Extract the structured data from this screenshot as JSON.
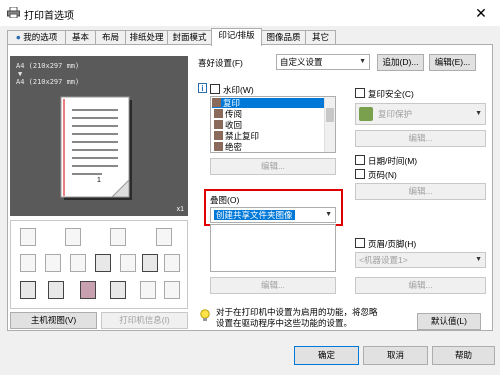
{
  "window": {
    "title": "打印首选项",
    "close_glyph": "✕"
  },
  "tabs": [
    "我的选项",
    "基本",
    "布局",
    "排纸处理",
    "封面模式",
    "印记/排版",
    "图像品质",
    "其它"
  ],
  "preview": {
    "line1": "A4 (210x297 mm)",
    "arrow": "▼",
    "line2": "A4 (210x297 mm)",
    "copies": "x1",
    "page_num": "1"
  },
  "left_buttons": {
    "main_view": "主机视图(V)",
    "printer_info": "打印机信息(I)"
  },
  "favorite": {
    "label": "喜好设置(F)",
    "value": "自定义设置",
    "add": "追加(D)...",
    "edit": "编辑(E)..."
  },
  "watermark": {
    "label": "水印(W)",
    "items": [
      "复印",
      "传阅",
      "收回",
      "禁止复印",
      "绝密"
    ],
    "edit": "编辑..."
  },
  "overlay": {
    "label": "叠图(O)",
    "value": "创建共享文件夹图像",
    "edit": "编辑..."
  },
  "copy_security": {
    "label": "复印安全(C)",
    "value": "复印保护",
    "edit": "编辑..."
  },
  "datetime": {
    "label": "日期/时间(M)"
  },
  "page_number": {
    "label": "页码(N)",
    "edit": "编辑..."
  },
  "header_footer": {
    "label": "页眉/页脚(H)",
    "value": "<机器设置1>",
    "edit": "编辑..."
  },
  "note": {
    "line1": "对于在打印机中设置为启用的功能，将忽略",
    "line2": "设置在驱动程序中这些功能的设置。"
  },
  "default_button": "默认值(L)",
  "dialog_buttons": {
    "ok": "确定",
    "cancel": "取消",
    "help": "帮助"
  },
  "colors": {
    "highlight": "#e00000",
    "selection": "#0078d7"
  }
}
